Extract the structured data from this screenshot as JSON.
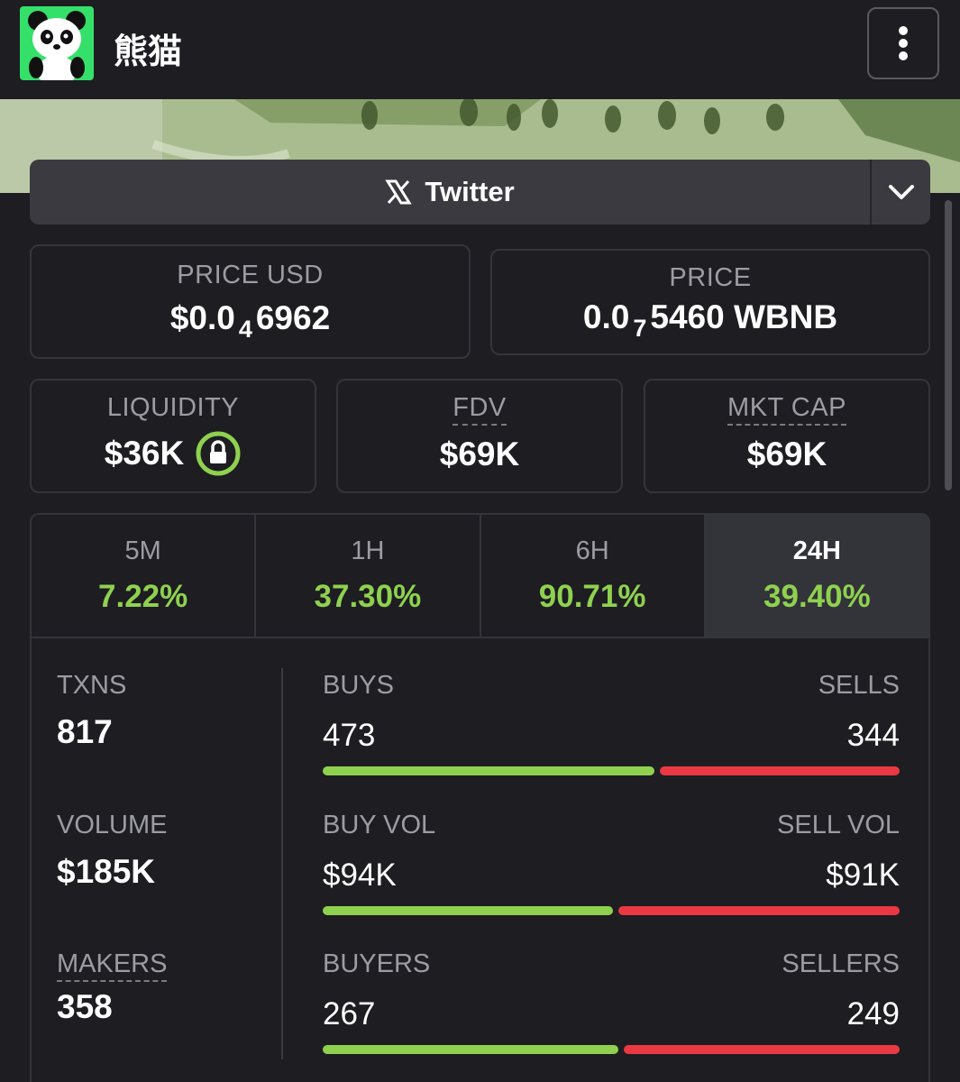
{
  "header": {
    "token_name": "熊猫",
    "logo_icon": "panda-logo-icon",
    "menu_icon": "vertical-dots-icon"
  },
  "twitter": {
    "label": "Twitter",
    "icon": "x-logo-icon",
    "chevron_icon": "chevron-down-icon"
  },
  "price_usd": {
    "label": "PRICE USD",
    "prefix": "$0.0",
    "zeros": "4",
    "digits": "6962"
  },
  "price_native": {
    "label": "PRICE",
    "prefix": "0.0",
    "zeros": "7",
    "digits": "5460 WBNB"
  },
  "liquidity": {
    "label": "LIQUIDITY",
    "value": "$36K",
    "icon": "lock-icon"
  },
  "fdv": {
    "label": "FDV",
    "value": "$69K"
  },
  "mkt_cap": {
    "label": "MKT CAP",
    "value": "$69K"
  },
  "timeframes": [
    {
      "label": "5M",
      "change": "7.22%"
    },
    {
      "label": "1H",
      "change": "37.30%"
    },
    {
      "label": "6H",
      "change": "90.71%"
    },
    {
      "label": "24H",
      "change": "39.40%",
      "active": true
    }
  ],
  "stats": {
    "txns": {
      "label": "TXNS",
      "value": "817"
    },
    "volume": {
      "label": "VOLUME",
      "value": "$185K"
    },
    "makers": {
      "label": "MAKERS",
      "value": "358"
    }
  },
  "splits": {
    "txns": {
      "left_label": "BUYS",
      "right_label": "SELLS",
      "left_value": "473",
      "right_value": "344",
      "buy_fraction": 0.579
    },
    "volume": {
      "left_label": "BUY VOL",
      "right_label": "SELL VOL",
      "left_value": "$94K",
      "right_value": "$91K",
      "buy_fraction": 0.508
    },
    "makers": {
      "left_label": "BUYERS",
      "right_label": "SELLERS",
      "left_value": "267",
      "right_value": "249",
      "buy_fraction": 0.517
    }
  },
  "colors": {
    "positive": "#8fd14f",
    "negative": "#ea3943",
    "logo_bg": "#35e06a"
  }
}
